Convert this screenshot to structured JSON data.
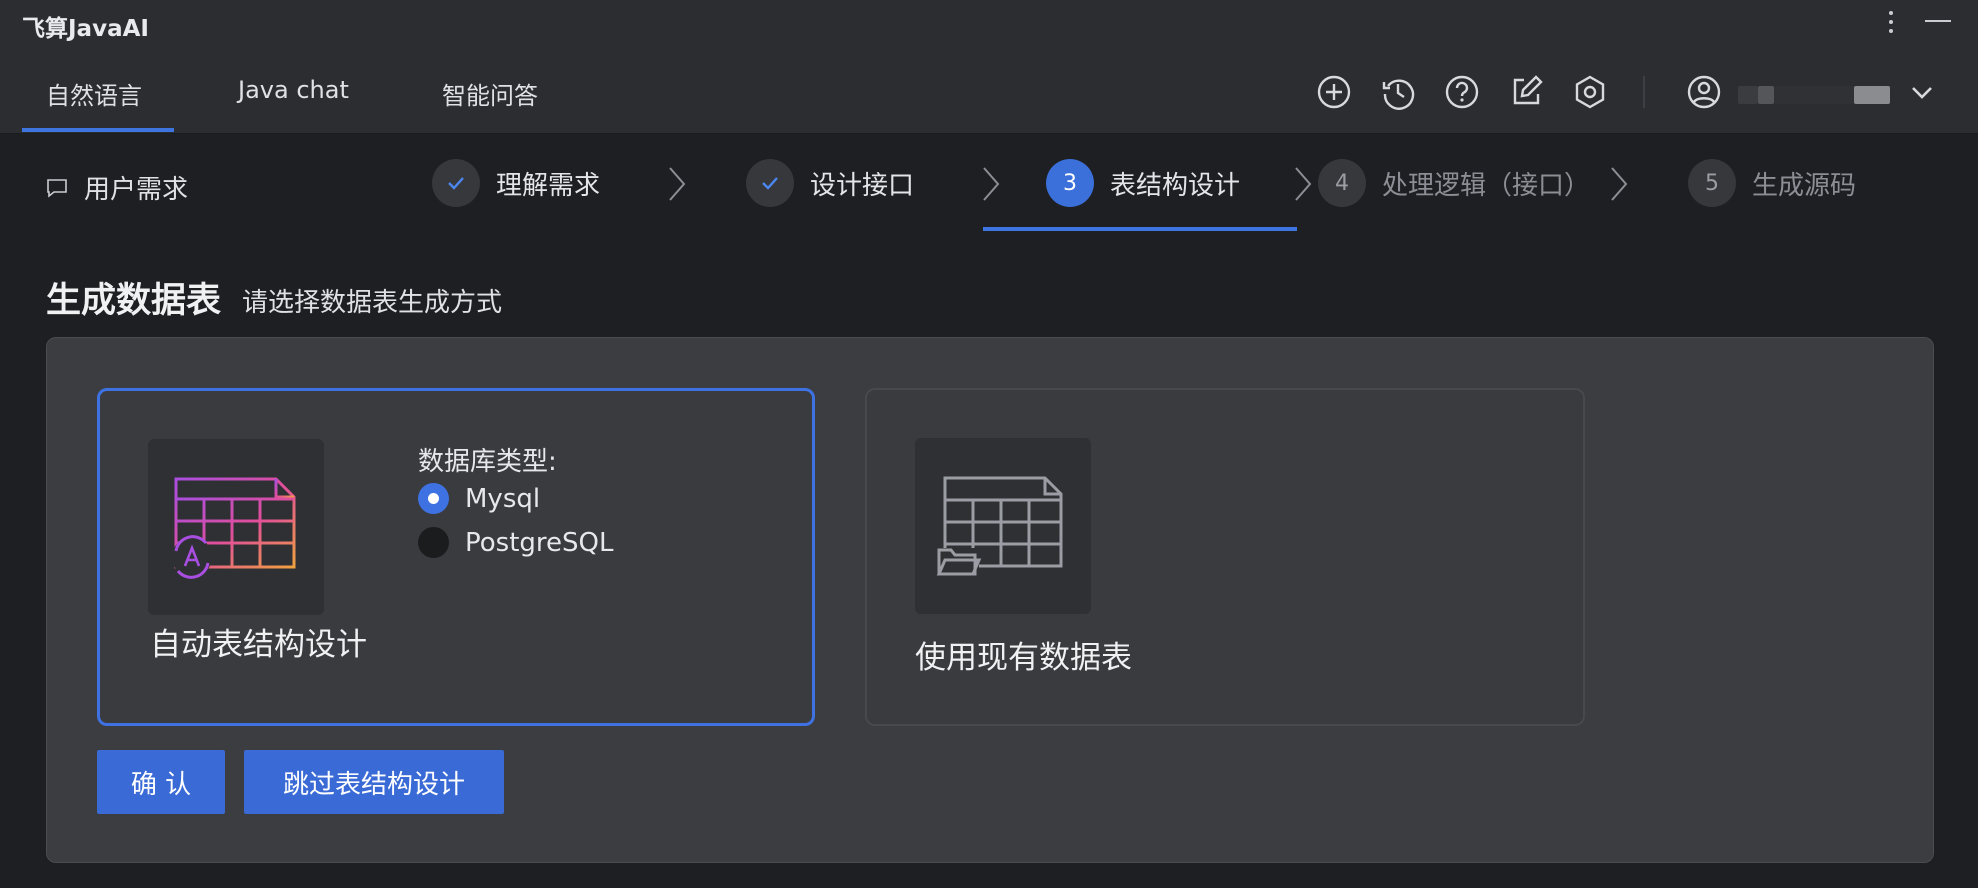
{
  "window": {
    "title": "飞算JavaAI"
  },
  "tabs": [
    {
      "label": "自然语言",
      "active": true
    },
    {
      "label": "Java chat",
      "active": false
    },
    {
      "label": "智能问答",
      "active": false
    }
  ],
  "toolbar_icons": [
    "add-icon",
    "history-icon",
    "help-icon",
    "edit-icon",
    "settings-icon",
    "user-icon",
    "chevron-down-icon"
  ],
  "steps": {
    "user_label": "用户需求",
    "items": [
      {
        "number": "",
        "label": "理解需求",
        "state": "done"
      },
      {
        "number": "",
        "label": "设计接口",
        "state": "done"
      },
      {
        "number": "3",
        "label": "表结构设计",
        "state": "active"
      },
      {
        "number": "4",
        "label": "处理逻辑（接口）",
        "state": "todo"
      },
      {
        "number": "5",
        "label": "生成源码",
        "state": "todo"
      }
    ]
  },
  "section": {
    "title": "生成数据表",
    "subtitle": "请选择数据表生成方式"
  },
  "cards": {
    "auto": {
      "title": "自动表结构设计",
      "db_type_label": "数据库类型:",
      "options": [
        {
          "label": "Mysql",
          "selected": true
        },
        {
          "label": "PostgreSQL",
          "selected": false
        }
      ]
    },
    "existing": {
      "title": "使用现有数据表"
    }
  },
  "buttons": {
    "confirm": "确 认",
    "skip": "跳过表结构设计"
  },
  "colors": {
    "accent": "#3d74e0",
    "background": "#1e1f22",
    "panel": "#3c3d40"
  }
}
